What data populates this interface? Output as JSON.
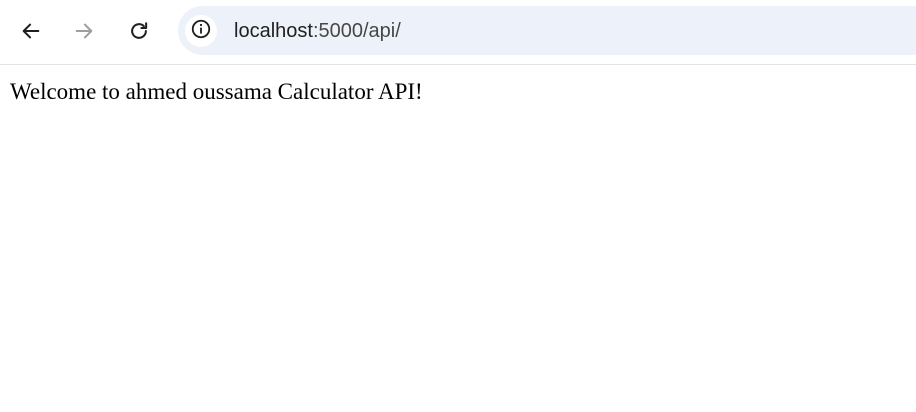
{
  "browser": {
    "back_icon": "arrow-left-icon",
    "forward_icon": "arrow-right-icon",
    "reload_icon": "reload-icon",
    "site_info_icon": "info-circle-icon",
    "address": {
      "host": "localhost",
      "path": ":5000/api/"
    },
    "omnibox_color": "#edf2fa"
  },
  "page": {
    "message": "Welcome to ahmed oussama Calculator API!"
  }
}
